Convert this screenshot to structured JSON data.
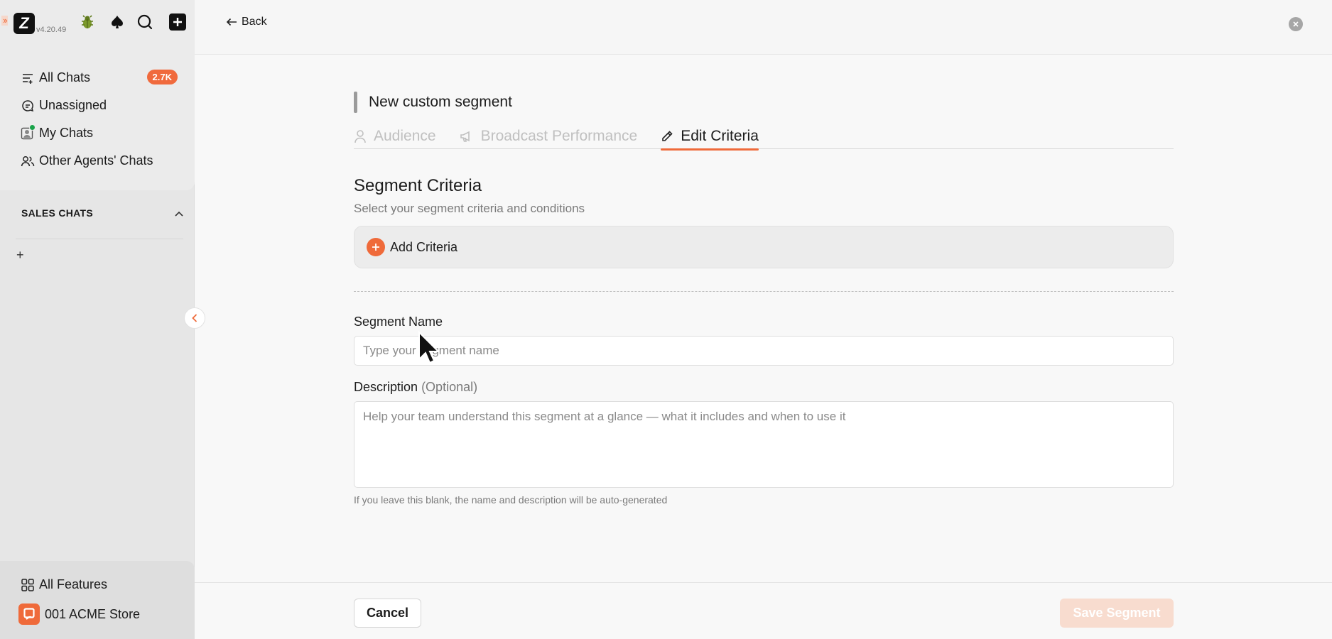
{
  "app": {
    "version": "v4.20.49",
    "brand_color": "#ef6a3a",
    "expand_glyph": "››"
  },
  "sidebar": {
    "top_icons": [
      "bug-icon",
      "spade-icon",
      "search-icon",
      "plus-square-icon"
    ],
    "nav": [
      {
        "label": "All Chats",
        "icon": "list-icon",
        "badge": "2.7K"
      },
      {
        "label": "Unassigned",
        "icon": "chat-bubble-icon"
      },
      {
        "label": "My Chats",
        "icon": "my-chats-icon",
        "online": true
      },
      {
        "label": "Other Agents' Chats",
        "icon": "users-icon"
      }
    ],
    "section": {
      "label": "SALES CHATS",
      "add": "+"
    },
    "bottom": {
      "all_features": "All Features",
      "store": "001 ACME Store"
    }
  },
  "header": {
    "back_label": "Back",
    "close_icon": "close-icon"
  },
  "page": {
    "title": "New custom segment",
    "tabs": [
      {
        "label": "Audience",
        "icon": "person-icon",
        "active": false
      },
      {
        "label": "Broadcast Performance",
        "icon": "megaphone-icon",
        "active": false
      },
      {
        "label": "Edit Criteria",
        "icon": "pencil-icon",
        "active": true
      }
    ],
    "criteria": {
      "title": "Segment Criteria",
      "subtitle": "Select your segment criteria and conditions",
      "add_label": "Add Criteria"
    },
    "form": {
      "name_label": "Segment Name",
      "name_placeholder": "Type your segment name",
      "name_value": "",
      "desc_label": "Description",
      "desc_optional": "(Optional)",
      "desc_placeholder": "Help your team understand this segment at a glance — what it includes and when to use it",
      "desc_value": "",
      "hint": "If you leave this blank, the name and description will be auto-generated"
    }
  },
  "footer": {
    "cancel_label": "Cancel",
    "save_label": "Save Segment"
  }
}
